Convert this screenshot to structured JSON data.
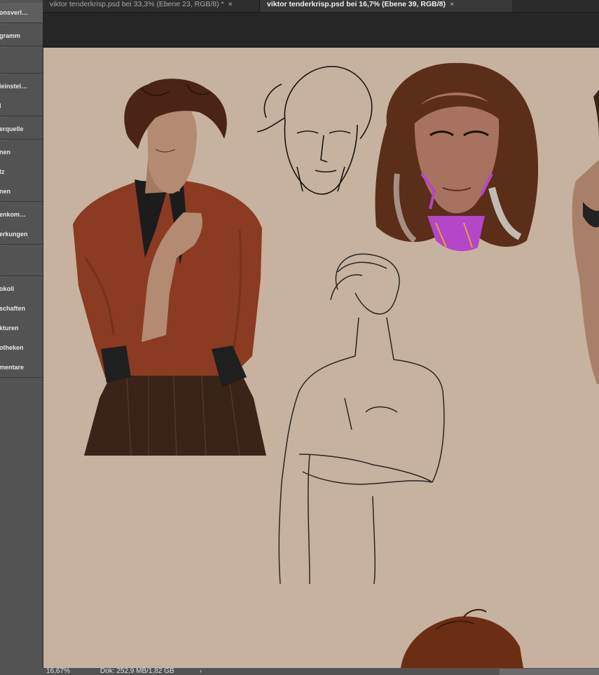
{
  "tabs": [
    {
      "label": "viktor tenderkrisp.psd bei 33,3% (Ebene 23, RGB/8) *",
      "active": false
    },
    {
      "label": "viktor tenderkrisp.psd bei 16,7% (Ebene 39, RGB/8)",
      "active": true
    }
  ],
  "tab_close_glyph": "×",
  "panels": {
    "group1": [
      "onsverl…"
    ],
    "group2": [
      "gramm"
    ],
    "group3": [
      ""
    ],
    "group4": [
      "leinstel…",
      "l"
    ],
    "group5": [
      "erquelle"
    ],
    "group6": [
      "nen",
      "tz",
      "nen"
    ],
    "group7": [
      "enkom…",
      "erkungen"
    ],
    "group8": [
      ""
    ],
    "group9": [
      "okoll",
      "schaften",
      "kturen",
      "otheken",
      "mentare"
    ]
  },
  "status": {
    "zoom": "16,67%",
    "doc": "Dok: 252,9 MB/1,82 GB",
    "arrow": "›"
  },
  "colors": {
    "canvas_bg": "#c7b29f",
    "panel_bg": "#535353",
    "app_bg": "#2b2b2b",
    "shirt": "#8a3b22",
    "hair": "#4a2414",
    "skin": "#b38a72",
    "accent_purple": "#b545c9"
  }
}
